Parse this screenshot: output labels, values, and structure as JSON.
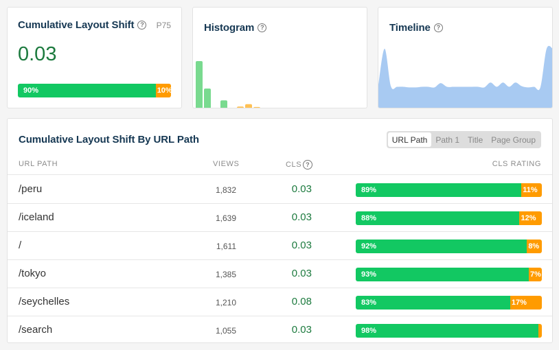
{
  "colors": {
    "good": "#12c862",
    "needs_improvement": "#ff9b00",
    "value_green": "#1c7a3e",
    "histogram_good": "#79da8f",
    "histogram_ni": "#ffc155",
    "timeline_fill": "#a8caf2"
  },
  "cls_card": {
    "title": "Cumulative Layout Shift",
    "help_icon": "?",
    "percentile": "P75",
    "value": "0.03",
    "rating": {
      "good": 90,
      "needs_improvement": 10,
      "good_label": "90%",
      "ni_label": "10%"
    }
  },
  "histogram_card": {
    "title": "Histogram",
    "help_icon": "?",
    "chart_data": {
      "type": "bar",
      "title": "Histogram",
      "bins": [
        {
          "value": 100,
          "rating": "good"
        },
        {
          "value": 42,
          "rating": "good"
        },
        {
          "value": 0,
          "rating": "good"
        },
        {
          "value": 17,
          "rating": "good"
        },
        {
          "value": 0,
          "rating": "good"
        },
        {
          "value": 4,
          "rating": "needs_improvement"
        },
        {
          "value": 9,
          "rating": "needs_improvement"
        },
        {
          "value": 3,
          "rating": "needs_improvement"
        }
      ],
      "ylim": [
        0,
        100
      ]
    }
  },
  "timeline_card": {
    "title": "Timeline",
    "help_icon": "?",
    "chart_data": {
      "type": "area",
      "title": "Timeline",
      "values": [
        40,
        100,
        38,
        37,
        37,
        36,
        36,
        37,
        37,
        36,
        43,
        37,
        37,
        37,
        37,
        37,
        37,
        36,
        44,
        37,
        44,
        37,
        44,
        38,
        36,
        37,
        36,
        100,
        100
      ],
      "ylim": [
        0,
        100
      ]
    }
  },
  "table_card": {
    "title": "Cumulative Layout Shift By URL Path",
    "tabs": [
      {
        "label": "URL Path",
        "active": true
      },
      {
        "label": "Path 1",
        "active": false
      },
      {
        "label": "Title",
        "active": false
      },
      {
        "label": "Page Group",
        "active": false
      }
    ],
    "headers": {
      "url": "URL PATH",
      "views": "VIEWS",
      "cls": "CLS",
      "rating": "CLS RATING"
    },
    "help_icon": "?",
    "rows": [
      {
        "url": "/peru",
        "views": "1,832",
        "cls": "0.03",
        "good": 89,
        "ni": 11,
        "good_label": "89%",
        "ni_label": "11%"
      },
      {
        "url": "/iceland",
        "views": "1,639",
        "cls": "0.03",
        "good": 88,
        "ni": 12,
        "good_label": "88%",
        "ni_label": "12%"
      },
      {
        "url": "/",
        "views": "1,611",
        "cls": "0.03",
        "good": 92,
        "ni": 8,
        "good_label": "92%",
        "ni_label": "8%"
      },
      {
        "url": "/tokyo",
        "views": "1,385",
        "cls": "0.03",
        "good": 93,
        "ni": 7,
        "good_label": "93%",
        "ni_label": "7%"
      },
      {
        "url": "/seychelles",
        "views": "1,210",
        "cls": "0.08",
        "good": 83,
        "ni": 17,
        "good_label": "83%",
        "ni_label": "17%"
      },
      {
        "url": "/search",
        "views": "1,055",
        "cls": "0.03",
        "good": 98,
        "ni": 2,
        "good_label": "98%",
        "ni_label": ""
      }
    ]
  }
}
